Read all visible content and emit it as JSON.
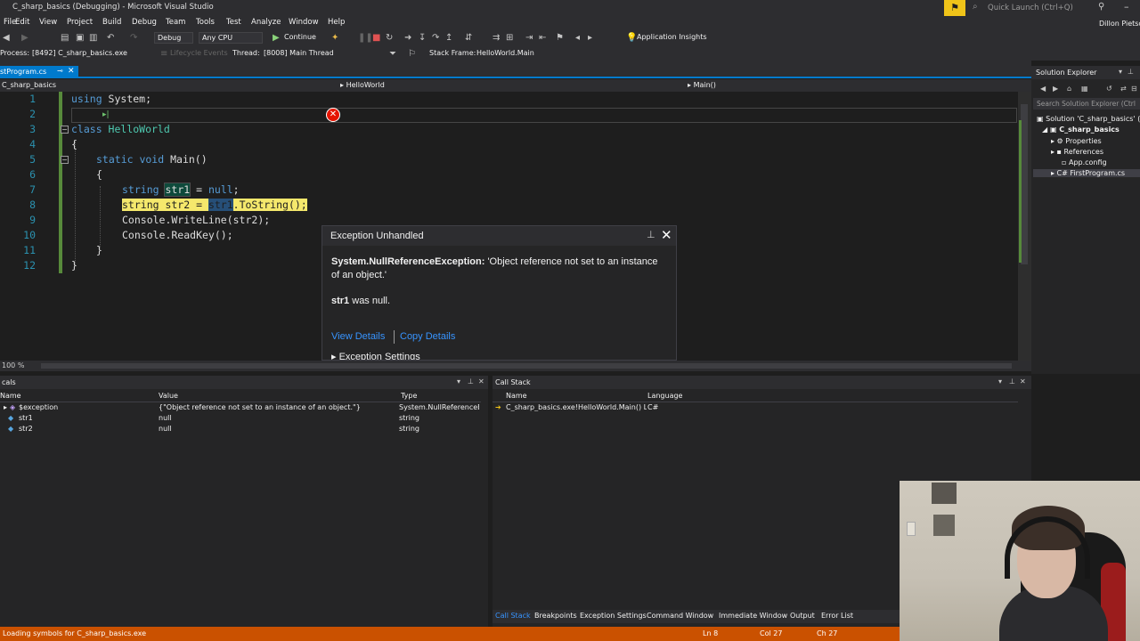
{
  "window": {
    "title": "C_sharp_basics (Debugging) - Microsoft Visual Studio",
    "quick_launch": "Quick Launch (Ctrl+Q)",
    "user": "Dillon Pietsch"
  },
  "menu": [
    "File",
    "Edit",
    "View",
    "Project",
    "Build",
    "Debug",
    "Team",
    "Tools",
    "Test",
    "Analyze",
    "Window",
    "Help"
  ],
  "toolbar": {
    "config": "Debug",
    "platform": "Any CPU",
    "continue_label": "Continue",
    "insights_label": "Application Insights",
    "process_label": "Process:",
    "process_value": "[8492] C_sharp_basics.exe",
    "lifecycle_label": "Lifecycle Events",
    "thread_label": "Thread:",
    "thread_value": "[8008] Main Thread",
    "stackframe_label": "Stack Frame:",
    "stackframe_value": "HelloWorld.Main"
  },
  "document": {
    "tab_label": "stProgram.cs",
    "nav_project": "C_sharp_basics",
    "nav_class": "HelloWorld",
    "nav_member": "Main()"
  },
  "code": {
    "line_numbers": [
      "1",
      "2",
      "3",
      "4",
      "5",
      "6",
      "7",
      "8",
      "9",
      "10",
      "11",
      "12"
    ],
    "l1_kw": "using",
    "l1_rest": " System;",
    "l3_kw": "class",
    "l3_type": " HelloWorld",
    "l4": "{",
    "l5_kw": "static void",
    "l5_rest": " Main()",
    "l6": "{",
    "l7_kw": "string",
    "l7_sp": " ",
    "l7_var": "str1",
    "l7_mid": " = ",
    "l7_kw2": "null",
    "l7_end": ";",
    "l8_a": "string str2 = ",
    "l8_b": "str1",
    "l8_c": ".ToString();",
    "l9": "Console.WriteLine(str2);",
    "l10": "Console.ReadKey();",
    "l11": "}",
    "l12": "}"
  },
  "exception": {
    "title": "Exception Unhandled",
    "type": "System.NullReferenceException:",
    "message": " 'Object reference not set to an instance of an object.'",
    "var": "str1",
    "var_rest": " was null.",
    "view_details": "View Details",
    "copy_details": "Copy Details",
    "settings": "Exception Settings"
  },
  "editor": {
    "zoom": "100 %"
  },
  "solution_explorer": {
    "title": "Solution Explorer",
    "search_placeholder": "Search Solution Explorer (Ctrl",
    "items": [
      "Solution 'C_sharp_basics' (",
      "C_sharp_basics",
      "Properties",
      "References",
      "App.config",
      "FirstProgram.cs"
    ]
  },
  "locals": {
    "title": "cals",
    "columns": [
      "Name",
      "Value",
      "Type"
    ],
    "rows": [
      {
        "name": "$exception",
        "value": "{\"Object reference not set to an instance of an object.\"}",
        "type": "System.NullReferenceEx"
      },
      {
        "name": "str1",
        "value": "null",
        "type": "string"
      },
      {
        "name": "str2",
        "value": "null",
        "type": "string"
      }
    ]
  },
  "call_stack": {
    "title": "Call Stack",
    "columns": [
      "Name",
      "Language"
    ],
    "rows": [
      {
        "name": "C_sharp_basics.exe!HelloWorld.Main() Line",
        "language": "C#"
      }
    ]
  },
  "bottom_tabs": [
    "Call Stack",
    "Breakpoints",
    "Exception Settings",
    "Command Window",
    "Immediate Window",
    "Output",
    "Error List"
  ],
  "status": {
    "message": "Loading symbols for C_sharp_basics.exe",
    "line": "Ln 8",
    "col": "Col 27",
    "ch": "Ch 27"
  },
  "colors": {
    "accent": "#007acc",
    "status_bar": "#ca5100",
    "current_statement": "#f5e86c",
    "error": "#e51400",
    "keyword": "#569cd6",
    "type": "#4ec9b0",
    "link": "#3794ff"
  }
}
